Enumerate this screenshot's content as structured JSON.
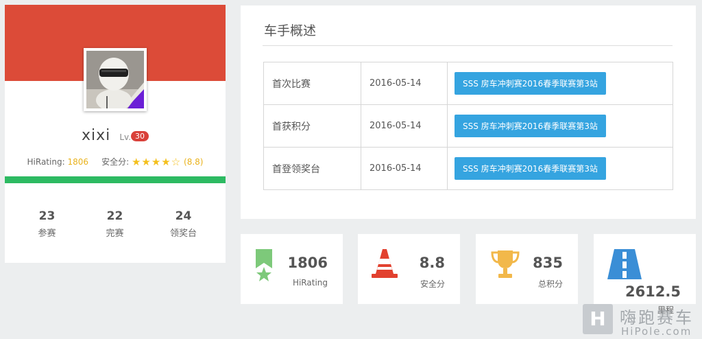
{
  "profile": {
    "username": "xixi",
    "level_prefix": "Lv.",
    "level": "30",
    "hirating_label": "HiRating:",
    "hirating_value": "1806",
    "safety_label": "安全分:",
    "safety_stars": "★★★★☆",
    "safety_score": "(8.8)",
    "stats": [
      {
        "value": "23",
        "label": "参赛"
      },
      {
        "value": "22",
        "label": "完赛"
      },
      {
        "value": "24",
        "label": "领奖台"
      }
    ]
  },
  "overview": {
    "title": "车手概述",
    "rows": [
      {
        "label": "首次比赛",
        "date": "2016-05-14",
        "event": "SSS 房车冲刺赛2016春季联赛第3站"
      },
      {
        "label": "首获积分",
        "date": "2016-05-14",
        "event": "SSS 房车冲刺赛2016春季联赛第3站"
      },
      {
        "label": "首登领奖台",
        "date": "2016-05-14",
        "event": "SSS 房车冲刺赛2016春季联赛第3站"
      }
    ]
  },
  "stat_cards": [
    {
      "icon": "ribbon-star-icon",
      "value": "1806",
      "label": "HiRating",
      "color": "#7dc97a"
    },
    {
      "icon": "traffic-cone-icon",
      "value": "8.8",
      "label": "安全分",
      "color": "#e2412f"
    },
    {
      "icon": "trophy-icon",
      "value": "835",
      "label": "总积分",
      "color": "#f2b84a"
    },
    {
      "icon": "road-icon",
      "value": "2612.5",
      "label": "里程",
      "color": "#3a8ed6"
    }
  ],
  "watermark": {
    "logo_text": "H",
    "text_cn": "嗨跑赛车",
    "text_en": "HiPole.com"
  },
  "colors": {
    "banner": "#dc4b38",
    "green_bar": "#2dba62",
    "link_button": "#35a4e0",
    "level_badge": "#d9413a"
  }
}
